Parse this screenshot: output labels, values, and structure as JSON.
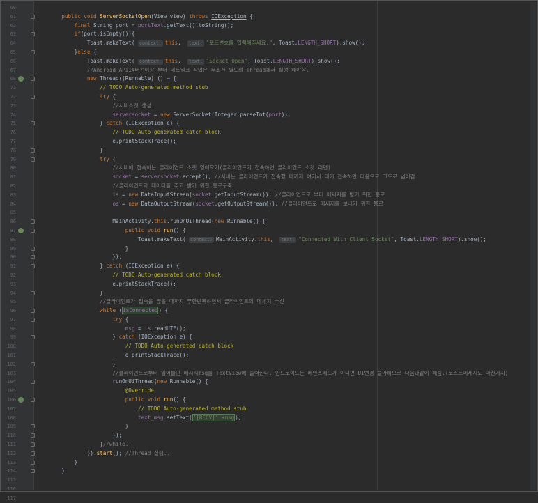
{
  "editor": {
    "lines": [
      {
        "n": "60",
        "segs": []
      },
      {
        "n": "61",
        "segs": [
          {
            "t": "    "
          },
          {
            "t": "public void ",
            "c": "kw"
          },
          {
            "t": "ServerSocketOpen",
            "c": "fn"
          },
          {
            "t": "(View view) "
          },
          {
            "t": "throws ",
            "c": "kw"
          },
          {
            "t": "IOException",
            "c": "ul"
          },
          {
            "t": " {"
          }
        ]
      },
      {
        "n": "62",
        "segs": [
          {
            "t": "        "
          },
          {
            "t": "final ",
            "c": "kw"
          },
          {
            "t": "String port = "
          },
          {
            "t": "portText",
            "c": "fld"
          },
          {
            "t": ".getText().toString();"
          }
        ]
      },
      {
        "n": "63",
        "segs": [
          {
            "t": "        "
          },
          {
            "t": "if",
            "c": "kw"
          },
          {
            "t": "(port.isEmpty()){"
          }
        ]
      },
      {
        "n": "64",
        "segs": [
          {
            "t": "            Toast.makeText( "
          },
          {
            "t": "context:",
            "c": "hint"
          },
          {
            "t": "this",
            "c": "kw"
          },
          {
            "t": ",  "
          },
          {
            "t": "text:",
            "c": "hint"
          },
          {
            "t": "\"포트번호를 입력해주세요.\"",
            "c": "str"
          },
          {
            "t": ", Toast."
          },
          {
            "t": "LENGTH_SHORT",
            "c": "fld"
          },
          {
            "t": ").show();"
          }
        ]
      },
      {
        "n": "65",
        "segs": [
          {
            "t": "        }"
          },
          {
            "t": "else ",
            "c": "kw"
          },
          {
            "t": "{"
          }
        ]
      },
      {
        "n": "66",
        "segs": [
          {
            "t": "            Toast.makeText( "
          },
          {
            "t": "context:",
            "c": "hint"
          },
          {
            "t": "this",
            "c": "kw"
          },
          {
            "t": ",  "
          },
          {
            "t": "text:",
            "c": "hint"
          },
          {
            "t": "\"Socket Open\"",
            "c": "str"
          },
          {
            "t": ", Toast."
          },
          {
            "t": "LENGTH_SHORT",
            "c": "fld"
          },
          {
            "t": ").show();"
          }
        ]
      },
      {
        "n": "67",
        "segs": [
          {
            "t": "            "
          },
          {
            "t": "//Android API14버전이상 부터 네트워크 작업은 무조건 별도의 Thread에서 실행 해야함.",
            "c": "cmt"
          }
        ]
      },
      {
        "n": "68",
        "segs": [
          {
            "t": "            "
          },
          {
            "t": "new ",
            "c": "kw"
          },
          {
            "t": "Thread((Runnable) () → {"
          }
        ],
        "mark": true
      },
      {
        "n": "71",
        "segs": [
          {
            "t": "                "
          },
          {
            "t": "// TODO Auto-generated method stub",
            "c": "ann"
          }
        ]
      },
      {
        "n": "72",
        "segs": [
          {
            "t": "                "
          },
          {
            "t": "try ",
            "c": "kw"
          },
          {
            "t": "{"
          }
        ]
      },
      {
        "n": "73",
        "segs": [
          {
            "t": "                    "
          },
          {
            "t": "//서버소켓 생성.",
            "c": "cmt"
          }
        ]
      },
      {
        "n": "74",
        "segs": [
          {
            "t": "                    "
          },
          {
            "t": "serversocket",
            "c": "fld"
          },
          {
            "t": " = "
          },
          {
            "t": "new ",
            "c": "kw"
          },
          {
            "t": "ServerSocket(Integer.parseInt("
          },
          {
            "t": "port",
            "c": "fld"
          },
          {
            "t": "));"
          }
        ]
      },
      {
        "n": "75",
        "segs": [
          {
            "t": "                } "
          },
          {
            "t": "catch ",
            "c": "kw"
          },
          {
            "t": "(IOException e) {"
          }
        ]
      },
      {
        "n": "76",
        "segs": [
          {
            "t": "                    "
          },
          {
            "t": "// TODO Auto-generated catch block",
            "c": "ann"
          }
        ]
      },
      {
        "n": "77",
        "segs": [
          {
            "t": "                    e.printStackTrace();"
          }
        ]
      },
      {
        "n": "78",
        "segs": [
          {
            "t": "                }"
          }
        ]
      },
      {
        "n": "79",
        "segs": [
          {
            "t": "                "
          },
          {
            "t": "try ",
            "c": "kw"
          },
          {
            "t": "{"
          }
        ]
      },
      {
        "n": "80",
        "segs": [
          {
            "t": "                    "
          },
          {
            "t": "//서버에 접속하는 클라이언트 소켓 얻어오기(클라이언트가 접속하면 클라이언트 소켓 리턴)",
            "c": "cmt"
          }
        ]
      },
      {
        "n": "81",
        "segs": [
          {
            "t": "                    "
          },
          {
            "t": "socket",
            "c": "fld"
          },
          {
            "t": " = "
          },
          {
            "t": "serversocket",
            "c": "fld"
          },
          {
            "t": ".accept(); "
          },
          {
            "t": "//서버는 클라이언트가 접속할 때까지 여기서 대기 접속하면 다음으로 코드로 넘어감",
            "c": "cmt"
          }
        ]
      },
      {
        "n": "82",
        "segs": [
          {
            "t": "                    "
          },
          {
            "t": "//클라이언트와 데이터를 주고 받기 위한 통로구축",
            "c": "cmt"
          }
        ]
      },
      {
        "n": "83",
        "segs": [
          {
            "t": "                    "
          },
          {
            "t": "is",
            "c": "fld"
          },
          {
            "t": " = "
          },
          {
            "t": "new ",
            "c": "kw"
          },
          {
            "t": "DataInputStream("
          },
          {
            "t": "socket",
            "c": "fld"
          },
          {
            "t": ".getInputStream()); "
          },
          {
            "t": "//클라이언트로 부터 메세지를 받기 위한 통로",
            "c": "cmt"
          }
        ]
      },
      {
        "n": "84",
        "segs": [
          {
            "t": "                    "
          },
          {
            "t": "os",
            "c": "fld"
          },
          {
            "t": " = "
          },
          {
            "t": "new ",
            "c": "kw"
          },
          {
            "t": "DataOutputStream("
          },
          {
            "t": "socket",
            "c": "fld"
          },
          {
            "t": ".getOutputStream()); "
          },
          {
            "t": "//클라이언트로 메세지를 보내기 위한 통로",
            "c": "cmt"
          }
        ]
      },
      {
        "n": "85",
        "segs": []
      },
      {
        "n": "86",
        "segs": [
          {
            "t": "                    MainActivity."
          },
          {
            "t": "this",
            "c": "kw"
          },
          {
            "t": ".runOnUiThread("
          },
          {
            "t": "new ",
            "c": "kw"
          },
          {
            "t": "Runnable() {"
          }
        ]
      },
      {
        "n": "87",
        "segs": [
          {
            "t": "                        "
          },
          {
            "t": "public void ",
            "c": "kw"
          },
          {
            "t": "run",
            "c": "fn"
          },
          {
            "t": "() {"
          }
        ],
        "mark": true
      },
      {
        "n": "88",
        "segs": [
          {
            "t": "                            Toast.makeText( "
          },
          {
            "t": "context:",
            "c": "hint"
          },
          {
            "t": "MainActivity."
          },
          {
            "t": "this",
            "c": "kw"
          },
          {
            "t": ",  "
          },
          {
            "t": "text:",
            "c": "hint"
          },
          {
            "t": "\"Connected With Client Socket\"",
            "c": "str"
          },
          {
            "t": ", Toast."
          },
          {
            "t": "LENGTH_SHORT",
            "c": "fld"
          },
          {
            "t": ").show();"
          }
        ]
      },
      {
        "n": "89",
        "segs": [
          {
            "t": "                        }"
          }
        ]
      },
      {
        "n": "90",
        "segs": [
          {
            "t": "                    });"
          }
        ]
      },
      {
        "n": "91",
        "segs": [
          {
            "t": "                } "
          },
          {
            "t": "catch ",
            "c": "kw"
          },
          {
            "t": "(IOException e) {"
          }
        ]
      },
      {
        "n": "92",
        "segs": [
          {
            "t": "                    "
          },
          {
            "t": "// TODO Auto-generated catch block",
            "c": "ann"
          }
        ]
      },
      {
        "n": "93",
        "segs": [
          {
            "t": "                    e.printStackTrace();"
          }
        ]
      },
      {
        "n": "94",
        "segs": [
          {
            "t": "                }"
          }
        ]
      },
      {
        "n": "95",
        "segs": [
          {
            "t": "                "
          },
          {
            "t": "//클라이언트가 접속을 끊을 때까지 무한반복하면서 클라이언트의 메세지 수신",
            "c": "cmt"
          }
        ]
      },
      {
        "n": "96",
        "segs": [
          {
            "t": "                "
          },
          {
            "t": "while ",
            "c": "kw"
          },
          {
            "t": "("
          },
          {
            "t": "isConnected",
            "c": "hlf"
          },
          {
            "t": ") {"
          }
        ]
      },
      {
        "n": "97",
        "segs": [
          {
            "t": "                    "
          },
          {
            "t": "try ",
            "c": "kw"
          },
          {
            "t": "{"
          }
        ]
      },
      {
        "n": "98",
        "segs": [
          {
            "t": "                        "
          },
          {
            "t": "msg",
            "c": "fld"
          },
          {
            "t": " = "
          },
          {
            "t": "is",
            "c": "fld"
          },
          {
            "t": ".readUTF();"
          }
        ]
      },
      {
        "n": "99",
        "segs": [
          {
            "t": "                    } "
          },
          {
            "t": "catch ",
            "c": "kw"
          },
          {
            "t": "(IOException e) {"
          }
        ]
      },
      {
        "n": "100",
        "segs": [
          {
            "t": "                        "
          },
          {
            "t": "// TODO Auto-generated catch block",
            "c": "ann"
          }
        ]
      },
      {
        "n": "101",
        "segs": [
          {
            "t": "                        e.printStackTrace();"
          }
        ]
      },
      {
        "n": "102",
        "segs": [
          {
            "t": "                    }"
          }
        ]
      },
      {
        "n": "103",
        "segs": [
          {
            "t": "                    "
          },
          {
            "t": "//클라이언트로부터 읽어들인 메시지msg를 TextView에 출력한다. 안드로이드는 메인스레드가 아니면 UI변경 불가하므로 다음과같이 해줌.(토스트메세지도 마찬가지)",
            "c": "cmt"
          }
        ]
      },
      {
        "n": "104",
        "segs": [
          {
            "t": "                    runOnUiThread("
          },
          {
            "t": "new ",
            "c": "kw"
          },
          {
            "t": "Runnable() {"
          }
        ]
      },
      {
        "n": "105",
        "segs": [
          {
            "t": "                        "
          },
          {
            "t": "@Override",
            "c": "ann"
          }
        ]
      },
      {
        "n": "106",
        "segs": [
          {
            "t": "                        "
          },
          {
            "t": "public void ",
            "c": "kw"
          },
          {
            "t": "run",
            "c": "fn"
          },
          {
            "t": "() {"
          }
        ],
        "mark": true
      },
      {
        "n": "107",
        "segs": [
          {
            "t": "                            "
          },
          {
            "t": "// TODO Auto-generated method stub",
            "c": "ann"
          }
        ]
      },
      {
        "n": "108",
        "segs": [
          {
            "t": "                            "
          },
          {
            "t": "text_msg",
            "c": "fld"
          },
          {
            "t": ".setText("
          },
          {
            "t": "\"[RECV]\" +msg",
            "c": "hlstr"
          },
          {
            "t": ");"
          }
        ]
      },
      {
        "n": "109",
        "segs": [
          {
            "t": "                        }"
          }
        ]
      },
      {
        "n": "110",
        "segs": [
          {
            "t": "                    });"
          }
        ]
      },
      {
        "n": "111",
        "segs": [
          {
            "t": "                }"
          },
          {
            "t": "//while..",
            "c": "cmt"
          }
        ]
      },
      {
        "n": "112",
        "segs": [
          {
            "t": "            })."
          },
          {
            "t": "start",
            "c": "fn"
          },
          {
            "t": "(); "
          },
          {
            "t": "//Thread 실행..",
            "c": "cmt"
          }
        ]
      },
      {
        "n": "113",
        "segs": [
          {
            "t": "        }"
          }
        ]
      },
      {
        "n": "114",
        "segs": [
          {
            "t": "    }"
          }
        ]
      },
      {
        "n": "115",
        "segs": []
      },
      {
        "n": "116",
        "segs": []
      },
      {
        "n": "117",
        "segs": []
      }
    ]
  },
  "colors": {
    "background": "#2b2b2b",
    "gutter": "#313335",
    "keyword": "#cc7832",
    "string": "#6a8759",
    "comment": "#808080",
    "field": "#9876aa",
    "method": "#ffc66d"
  }
}
